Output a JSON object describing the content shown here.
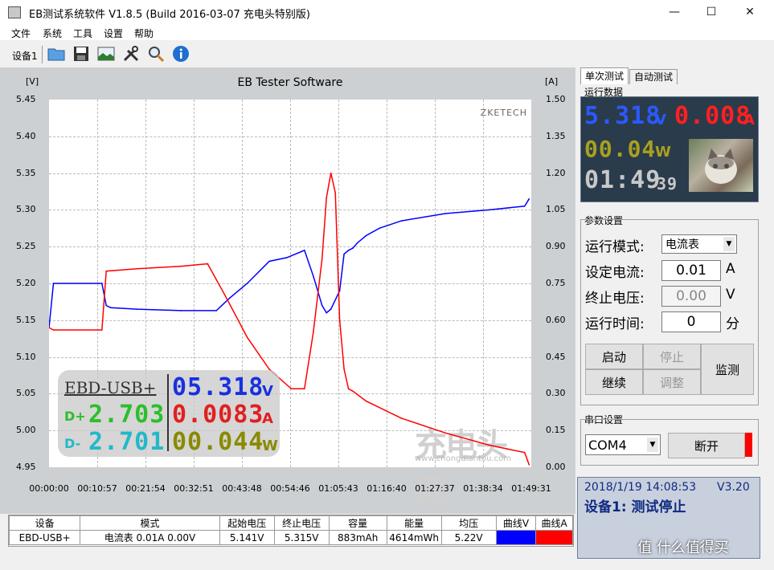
{
  "window": {
    "title": "EB测试系统软件 V1.8.5 (Build 2016-03-07 充电头特别版)",
    "min": "—",
    "max": "☐",
    "close": "✕"
  },
  "menu": [
    "文件",
    "系统",
    "工具",
    "设置",
    "帮助"
  ],
  "toolbar": {
    "device_label": "设备1",
    "icons": [
      "folder-icon",
      "save-icon",
      "image-icon",
      "tools-icon",
      "search-icon",
      "info-icon"
    ]
  },
  "chart_data": {
    "type": "line",
    "title": "EB Tester Software",
    "watermark": "ZKETECH",
    "y_left_unit": "[V]",
    "y_right_unit": "[A]",
    "y_left_ticks": [
      "5.45",
      "5.40",
      "5.35",
      "5.30",
      "5.25",
      "5.20",
      "5.15",
      "5.10",
      "5.05",
      "5.00",
      "4.95"
    ],
    "y_right_ticks": [
      "1.50",
      "1.35",
      "1.20",
      "1.05",
      "0.90",
      "0.75",
      "0.60",
      "0.45",
      "0.30",
      "0.15",
      "0.00"
    ],
    "x_ticks": [
      "00:00:00",
      "00:10:57",
      "00:21:54",
      "00:32:51",
      "00:43:48",
      "00:54:46",
      "01:05:43",
      "01:16:40",
      "01:27:37",
      "01:38:34",
      "01:49:31"
    ],
    "ylim_left": [
      4.95,
      5.45
    ],
    "ylim_right": [
      0.0,
      1.5
    ],
    "x_minutes_range": [
      0,
      109.5
    ],
    "series": [
      {
        "name": "曲线V",
        "color": "#0000ff",
        "axis": "left",
        "x": [
          0,
          1,
          12,
          13,
          14,
          20,
          30,
          38,
          41,
          45,
          50,
          54,
          58,
          60,
          62,
          63,
          64,
          66,
          67,
          68,
          69,
          70,
          72,
          75,
          80,
          90,
          100,
          108,
          109
        ],
        "y": [
          5.14,
          5.2,
          5.2,
          5.17,
          5.167,
          5.165,
          5.163,
          5.163,
          5.18,
          5.2,
          5.23,
          5.235,
          5.245,
          5.21,
          5.17,
          5.16,
          5.165,
          5.19,
          5.24,
          5.245,
          5.248,
          5.255,
          5.265,
          5.275,
          5.285,
          5.295,
          5.3,
          5.305,
          5.315
        ]
      },
      {
        "name": "曲线A",
        "color": "#ff0000",
        "axis": "right",
        "x": [
          0,
          1,
          12,
          13,
          20,
          30,
          36,
          40,
          45,
          50,
          55,
          58,
          60,
          62,
          63,
          64,
          65,
          66,
          67,
          68,
          69,
          72,
          80,
          90,
          100,
          108,
          109
        ],
        "y": [
          0.57,
          0.56,
          0.56,
          0.8,
          0.81,
          0.82,
          0.83,
          0.7,
          0.53,
          0.4,
          0.32,
          0.32,
          0.55,
          0.85,
          1.1,
          1.2,
          1.12,
          0.6,
          0.4,
          0.32,
          0.31,
          0.27,
          0.2,
          0.14,
          0.09,
          0.06,
          0.01
        ]
      }
    ]
  },
  "overlay": {
    "model": "EBD-USB+",
    "v": "05.318",
    "v_unit": "V",
    "dp_label": "D+",
    "dp": "2.703",
    "a": "0.0083",
    "a_unit": "A",
    "dm_label": "D-",
    "dm": "2.701",
    "w": "00.044",
    "w_unit": "W"
  },
  "tabs": [
    "单次测试",
    "自动测试"
  ],
  "run_data": {
    "title": "运行数据",
    "voltage": "5.318",
    "v_unit": "V",
    "current": "0.008",
    "a_unit": "A",
    "power": "00.04",
    "w_unit": "W",
    "time": "01:49",
    "seconds": "39"
  },
  "params": {
    "title": "参数设置",
    "mode_label": "运行模式:",
    "mode_value": "电流表",
    "set_current_label": "设定电流:",
    "set_current": "0.01",
    "set_current_unit": "A",
    "stop_v_label": "终止电压:",
    "stop_v": "0.00",
    "stop_v_unit": "V",
    "run_time_label": "运行时间:",
    "run_time": "0",
    "run_time_unit": "分"
  },
  "buttons": {
    "start": "启动",
    "stop": "停止",
    "continue": "继续",
    "adjust": "调整",
    "monitor": "监测"
  },
  "serial": {
    "title": "串口设置",
    "port": "COM4",
    "disconnect": "断开"
  },
  "status": {
    "datetime": "2018/1/19 14:08:53",
    "version": "V3.20",
    "message": "设备1: 测试停止"
  },
  "table": {
    "headers": [
      "设备",
      "模式",
      "起始电压",
      "终止电压",
      "容量",
      "能量",
      "均压",
      "曲线V",
      "曲线A"
    ],
    "row": [
      "EBD-USB+",
      "电流表  0.01A  0.00V",
      "5.141V",
      "5.315V",
      "883mAh",
      "4614mWh",
      "5.22V",
      "",
      ""
    ]
  },
  "watermarks": {
    "center": "充电头网",
    "center_url": "www.chongdiantou.com",
    "corner": "值 什么值得买"
  },
  "colors": {
    "volt_blue": "#0000ff",
    "amp_red": "#ff0000",
    "watt_olive": "#8a8a00",
    "panel_dark": "#293a4a",
    "status_blue": "#1a3a8a"
  }
}
